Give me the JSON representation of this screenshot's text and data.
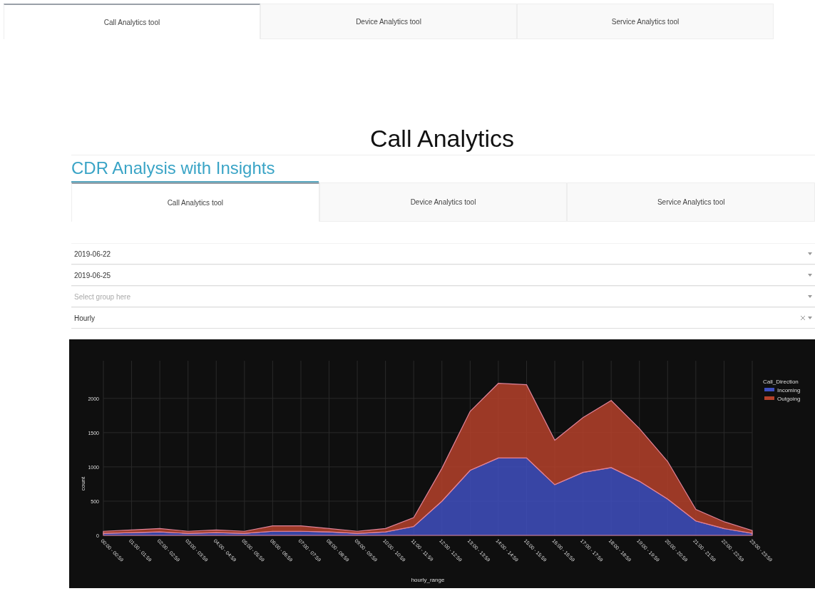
{
  "top_tabs": [
    {
      "label": "Call Analytics tool",
      "selected": true
    },
    {
      "label": "Device Analytics tool",
      "selected": false
    },
    {
      "label": "Service Analytics tool",
      "selected": false
    }
  ],
  "title": "Call Analytics",
  "header": "CDR Analysis with Insights",
  "tabs": [
    {
      "label": "Call Analytics tool",
      "selected": true
    },
    {
      "label": "Device Analytics tool",
      "selected": false
    },
    {
      "label": "Service Analytics tool",
      "selected": false
    }
  ],
  "filters": [
    {
      "value": "2019-06-22",
      "clearable": false
    },
    {
      "value": "2019-06-25",
      "clearable": false
    },
    {
      "placeholder": "Select group here",
      "clearable": false
    },
    {
      "value": "Hourly",
      "clearable": true
    }
  ],
  "chart": {
    "chart_data": {
      "type": "area",
      "stacked": true,
      "xlabel": "hourly_range",
      "ylabel": "count",
      "grid": true,
      "legend": {
        "title": "Call_Direction"
      },
      "categories": [
        "00:00 - 00:59",
        "01:00 - 01:59",
        "02:00 - 02:59",
        "03:00 - 03:59",
        "04:00 - 04:59",
        "05:00 - 05:59",
        "06:00 - 06:59",
        "07:00 - 07:59",
        "08:00 - 08:59",
        "09:00 - 09:59",
        "10:00 - 10:59",
        "11:00 - 11:59",
        "12:00 - 12:59",
        "13:00 - 13:59",
        "14:00 - 14:59",
        "15:00 - 15:59",
        "16:00 - 16:59",
        "17:00 - 17:59",
        "18:00 - 18:59",
        "19:00 - 19:59",
        "20:00 - 20:59",
        "21:00 - 21:59",
        "22:00 - 22:59",
        "23:00 - 23:59"
      ],
      "ylim": [
        0,
        2550
      ],
      "yticks": [
        0,
        500,
        1000,
        1500,
        2000
      ],
      "series": [
        {
          "name": "Incoming",
          "color": "#3f4fbf",
          "values": [
            30,
            40,
            50,
            30,
            40,
            30,
            60,
            60,
            50,
            30,
            50,
            130,
            500,
            950,
            1130,
            1130,
            740,
            920,
            990,
            790,
            530,
            210,
            100,
            30
          ]
        },
        {
          "name": "Outgoing",
          "color": "#b5412a",
          "values": [
            30,
            40,
            50,
            30,
            40,
            30,
            80,
            80,
            50,
            30,
            50,
            130,
            480,
            860,
            1090,
            1070,
            650,
            800,
            980,
            770,
            550,
            170,
            100,
            40
          ]
        }
      ]
    }
  }
}
